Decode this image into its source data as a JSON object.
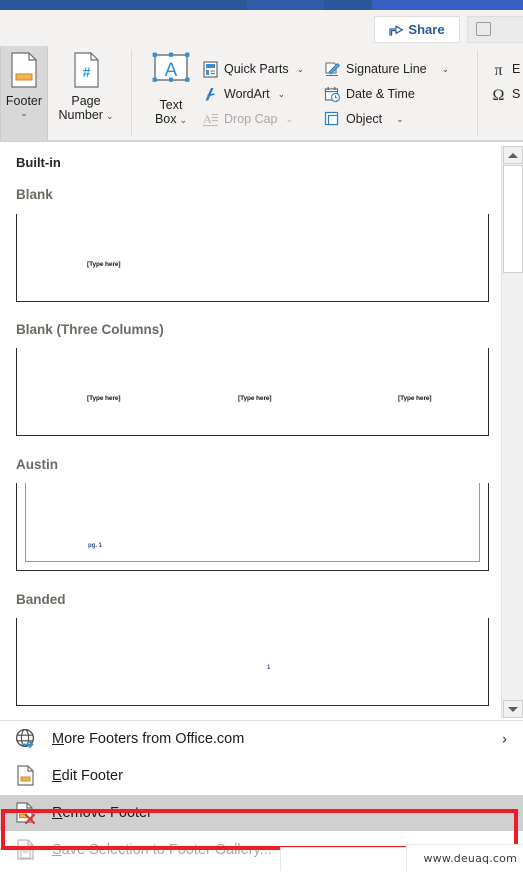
{
  "titlebar": {
    "present": true
  },
  "ribbon": {
    "share_label": "Share",
    "share_icon": "share-arrow-icon",
    "comments_icon": "comment-icon",
    "groups": [
      {
        "name": "header-footer-group",
        "buttons": [
          {
            "id": "footer",
            "label": "Footer",
            "icon": "footer-page-icon",
            "selected": true,
            "has_dropdown": true,
            "chevron": "⌄"
          },
          {
            "id": "page-number",
            "label_line1": "Page",
            "label_line2": "Number",
            "icon": "page-number-icon",
            "selected": false,
            "has_dropdown": true,
            "chevron": "⌄"
          }
        ]
      },
      {
        "name": "text-group",
        "big": {
          "id": "text-box",
          "label_line1": "Text",
          "label_line2": "Box",
          "icon": "text-box-icon",
          "chevron": "⌄"
        },
        "items": [
          {
            "id": "quick-parts",
            "label": "Quick Parts",
            "icon": "quick-parts-icon",
            "chevron": "⌄",
            "disabled": false
          },
          {
            "id": "wordart",
            "label": "WordArt",
            "icon": "wordart-icon",
            "chevron": "⌄",
            "disabled": false
          },
          {
            "id": "drop-cap",
            "label": "Drop Cap",
            "icon": "drop-cap-icon",
            "chevron": "⌄",
            "disabled": true
          }
        ]
      },
      {
        "name": "insert-group",
        "items": [
          {
            "id": "signature-line",
            "label": "Signature Line",
            "icon": "signature-line-icon",
            "chevron": "⌄",
            "disabled": false
          },
          {
            "id": "date-time",
            "label": "Date & Time",
            "icon": "calendar-clock-icon",
            "chevron": "",
            "disabled": false
          },
          {
            "id": "object",
            "label": "Object",
            "icon": "object-icon",
            "chevron": "⌄",
            "disabled": false
          }
        ]
      },
      {
        "name": "symbols-group",
        "items": [
          {
            "id": "equation",
            "label": "E",
            "icon": "pi-equation-icon",
            "chevron": "",
            "disabled": false
          },
          {
            "id": "symbol",
            "label": "S",
            "icon": "omega-symbol-icon",
            "chevron": "",
            "disabled": false
          }
        ]
      }
    ]
  },
  "gallery": {
    "section_header": "Built-in",
    "items": [
      {
        "id": "blank",
        "title": "Blank",
        "placeholders": [
          {
            "text": "[Type here]",
            "align": "left"
          }
        ]
      },
      {
        "id": "blank-three-columns",
        "title": "Blank (Three Columns)",
        "placeholders": [
          {
            "text": "[Type here]",
            "align": "left"
          },
          {
            "text": "[Type here]",
            "align": "center"
          },
          {
            "text": "[Type here]",
            "align": "right"
          }
        ]
      },
      {
        "id": "austin",
        "title": "Austin",
        "page_number_text": "pg. 1"
      },
      {
        "id": "banded",
        "title": "Banded",
        "page_number_text": "1"
      }
    ],
    "scrollbar": {
      "up_arrow": "scroll-up-arrow",
      "down_arrow": "scroll-down-arrow"
    }
  },
  "menu": {
    "items": [
      {
        "id": "more-footers",
        "accel": "M",
        "rest": "ore Footers from Office.com",
        "icon": "globe-icon",
        "has_submenu": true,
        "submenu_glyph": "›",
        "disabled": false,
        "highlighted": false
      },
      {
        "id": "edit-footer",
        "accel": "E",
        "rest": "dit Footer",
        "icon": "edit-footer-icon",
        "has_submenu": false,
        "submenu_glyph": "",
        "disabled": false,
        "highlighted": false
      },
      {
        "id": "remove-footer",
        "accel": "R",
        "rest": "emove Footer",
        "icon": "remove-footer-icon",
        "has_submenu": false,
        "submenu_glyph": "",
        "disabled": false,
        "highlighted": true
      },
      {
        "id": "save-selection",
        "accel": "S",
        "rest": "ave Selection to Footer Gallery...",
        "icon": "save-gallery-icon",
        "has_submenu": false,
        "submenu_glyph": "",
        "disabled": true,
        "highlighted": false
      }
    ],
    "highlight_color": "#ee1c25"
  },
  "watermark": {
    "text": "www.deuaq.com"
  }
}
